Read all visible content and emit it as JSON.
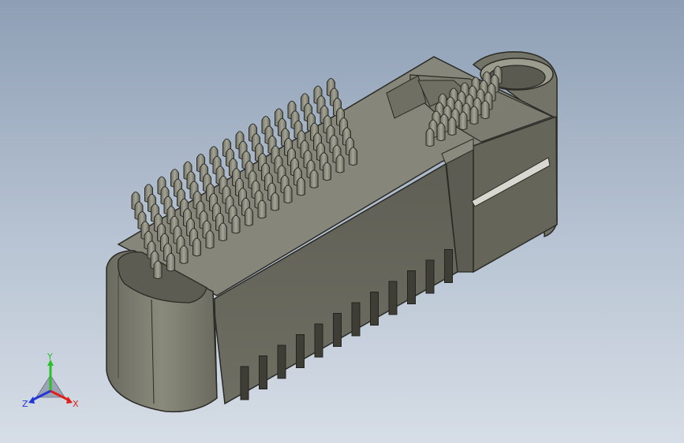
{
  "viewport": {
    "background_top": "#8e9fb5",
    "background_bottom": "#d6dde6"
  },
  "model": {
    "body_color": "#6b6b60",
    "top_color": "#8a8a7e",
    "edge_color": "#2a2a26",
    "pin_color": "#9a9a8c",
    "pin_rows_main": 8,
    "pin_columns_main": 16,
    "pin_rows_side": 5,
    "pin_columns_side": 6
  },
  "triad": {
    "x_label": "X",
    "y_label": "Y",
    "z_label": "Z",
    "x_color": "#e0201b",
    "y_color": "#2bbf2b",
    "z_color": "#2236d8"
  }
}
